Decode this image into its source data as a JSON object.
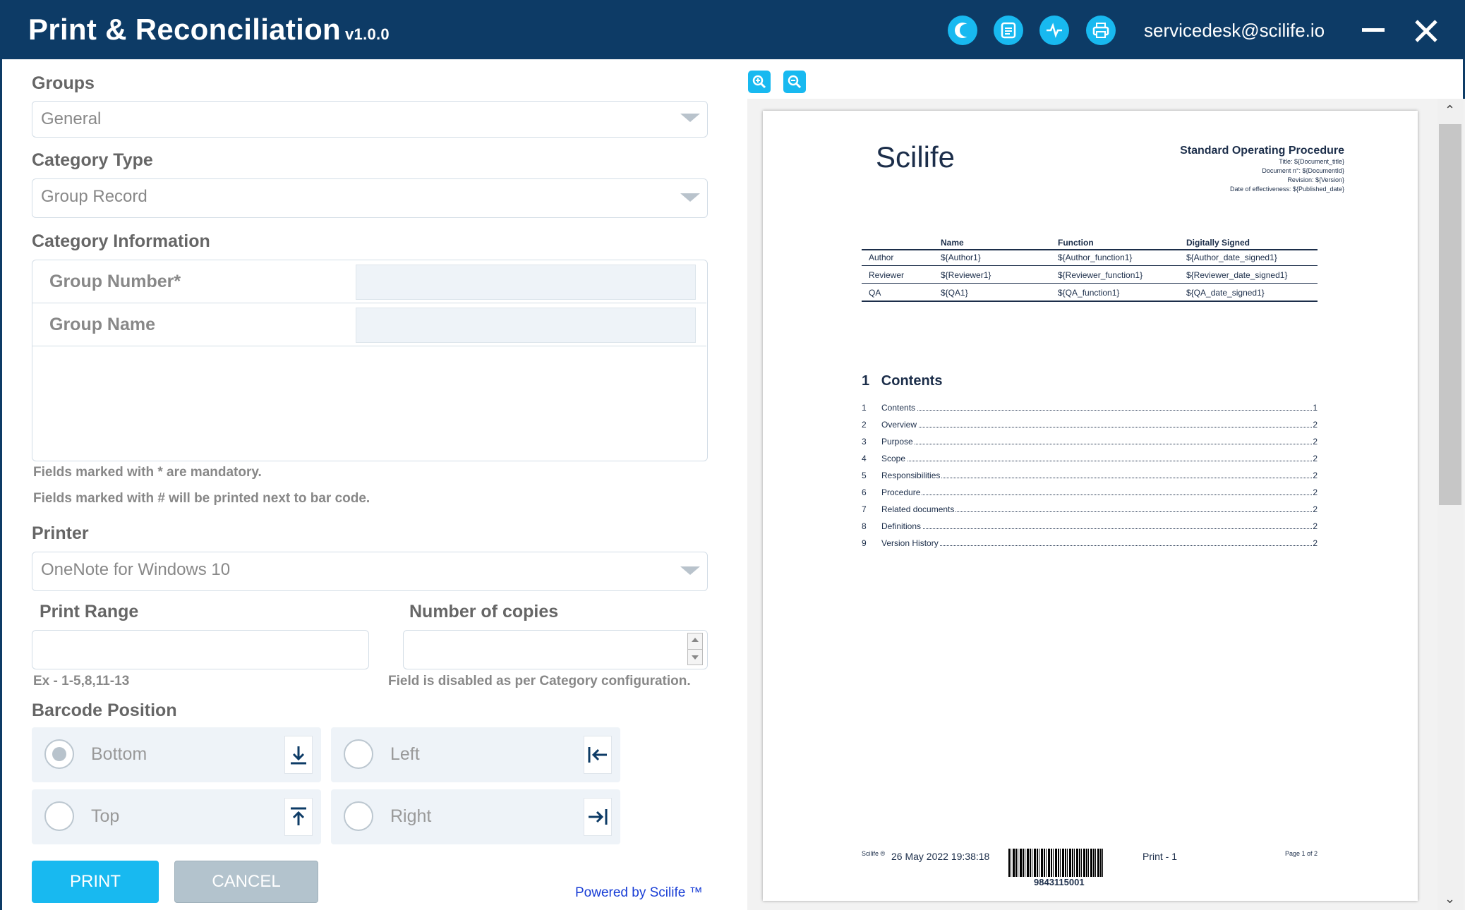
{
  "app": {
    "title": "Print & Reconciliation",
    "version": "v1.0.0",
    "user_email": "servicedesk@scilife.io"
  },
  "titlebar_icons": [
    "theme-toggle-icon",
    "release-notes-icon",
    "activity-pulse-icon",
    "printer-icon"
  ],
  "form": {
    "groups_label": "Groups",
    "groups_value": "General",
    "category_type_label": "Category Type",
    "category_type_value": "Group Record",
    "category_info_label": "Category Information",
    "group_number_label": "Group Number*",
    "group_name_label": "Group Name",
    "hint_mandatory": "Fields marked with * are mandatory.",
    "hint_barcode": "Fields marked with # will be printed next to bar code.",
    "printer_label": "Printer",
    "printer_value": "OneNote for Windows 10",
    "print_range_label": "Print Range",
    "print_range_hint": "Ex - 1-5,8,11-13",
    "copies_label": "Number of copies",
    "copies_hint": "Field is disabled as per Category configuration.",
    "barcode_label": "Barcode Position",
    "barcode_options": [
      "Bottom",
      "Left",
      "Top",
      "Right"
    ],
    "barcode_selected": "Bottom",
    "print_button": "PRINT",
    "cancel_button": "CANCEL",
    "powered_by": "Powered by Scilife ™"
  },
  "colors": {
    "titlebar": "#0d3b66",
    "accent": "#18b9f0",
    "cancel": "#b3c3cd"
  },
  "document": {
    "logo": "Scilife",
    "heading": "Standard Operating Procedure",
    "meta": [
      "Title: ${Document_title}",
      "Document n°: ${DocumentId}",
      "Revision: ${Version}",
      "Date of effectiveness: ${Published_date}"
    ],
    "sig_headers": [
      "Name",
      "Function",
      "Digitally Signed"
    ],
    "sig_rows": [
      [
        "Author",
        "${Author1}",
        "${Author_function1}",
        "${Author_date_signed1}"
      ],
      [
        "Reviewer",
        "${Reviewer1}",
        "${Reviewer_function1}",
        "${Reviewer_date_signed1}"
      ],
      [
        "QA",
        "${QA1}",
        "${QA_function1}",
        "${QA_date_signed1}"
      ]
    ],
    "contents_number": "1",
    "contents_title": "Contents",
    "toc": [
      [
        "1",
        "Contents",
        "1"
      ],
      [
        "2",
        "Overview",
        "2"
      ],
      [
        "3",
        "Purpose",
        "2"
      ],
      [
        "4",
        "Scope",
        "2"
      ],
      [
        "5",
        "Responsibilities",
        "2"
      ],
      [
        "6",
        "Procedure",
        "2"
      ],
      [
        "7",
        "Related documents",
        "2"
      ],
      [
        "8",
        "Definitions",
        "2"
      ],
      [
        "9",
        "Version History",
        "2"
      ]
    ],
    "footer_brand": "Scilife ®",
    "footer_timestamp": "26 May 2022 19:38:18",
    "footer_barcode": "9843115001",
    "footer_print": "Print - 1",
    "footer_page": "Page 1 of 2"
  }
}
